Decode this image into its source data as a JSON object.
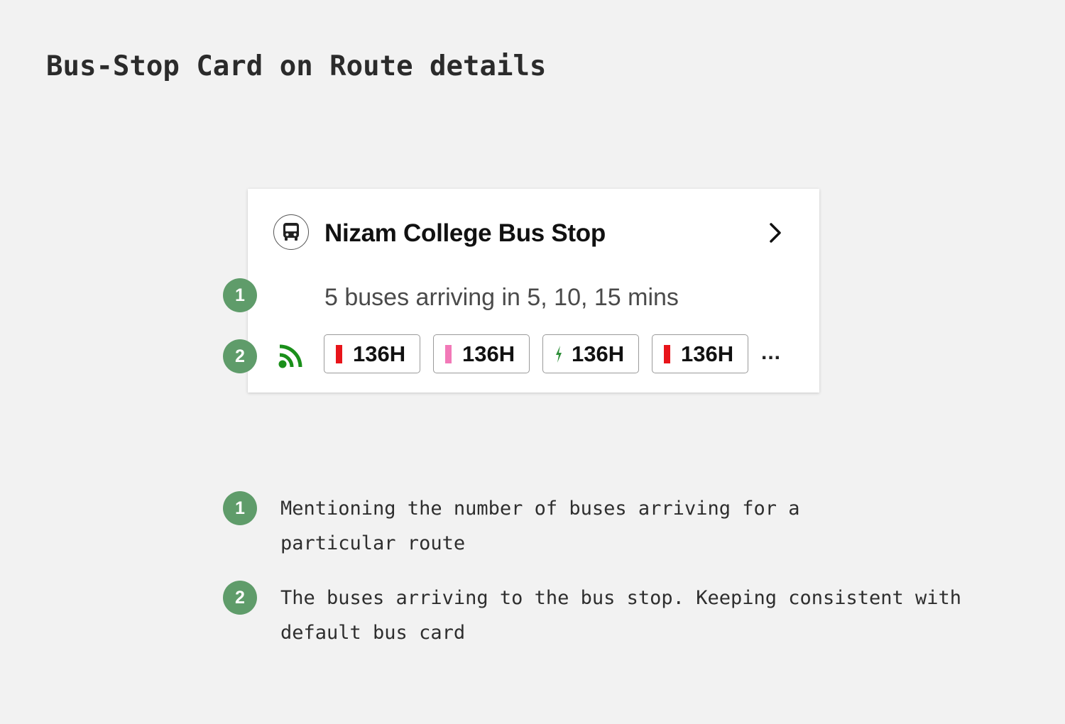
{
  "page": {
    "title": "Bus-Stop Card on Route details"
  },
  "card": {
    "stop_icon": "bus-icon",
    "stop_name": "Nizam College Bus Stop",
    "chevron_icon": "chevron-right-icon",
    "arrival_text": "5 buses arriving in 5, 10, 15 mins",
    "live_icon": "live-tracking-icon",
    "routes": [
      {
        "label": "136H",
        "indicator": "bar",
        "color": "#e8141a"
      },
      {
        "label": "136H",
        "indicator": "bar",
        "color": "#f279b8"
      },
      {
        "label": "136H",
        "indicator": "lightning-bolt",
        "color": "#2f8f3a"
      },
      {
        "label": "136H",
        "indicator": "bar",
        "color": "#e8141a"
      }
    ],
    "more_text": "..."
  },
  "annotations": [
    {
      "number": "1",
      "text": "Mentioning the number of buses arriving for a particular route"
    },
    {
      "number": "2",
      "text": "The buses arriving to the bus stop. Keeping consistent with default bus card"
    }
  ],
  "colors": {
    "background": "#f2f2f2",
    "badge": "#5f9c6a",
    "live": "#1a8f1a"
  }
}
